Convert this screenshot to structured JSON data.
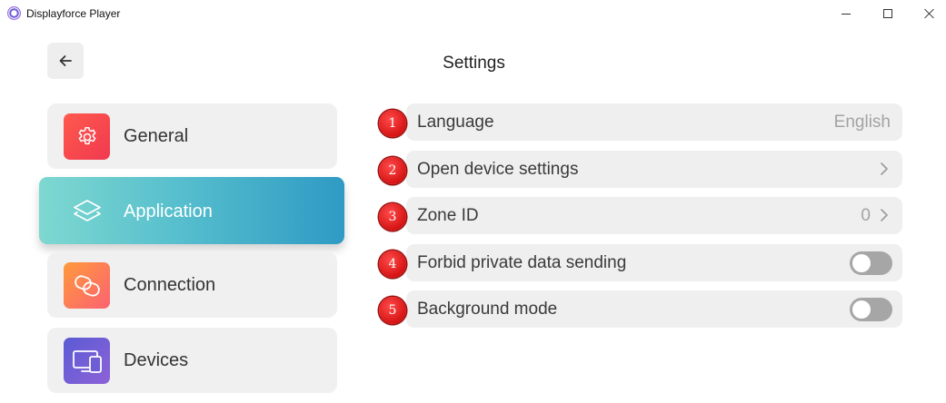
{
  "window": {
    "title": "Displayforce Player",
    "controls": {
      "minimize": "minimize-icon",
      "maximize": "maximize-icon",
      "close": "close-icon"
    }
  },
  "header": {
    "back_icon": "arrow-left-icon",
    "title": "Settings"
  },
  "sidebar": {
    "items": [
      {
        "label": "General",
        "icon": "gear-icon",
        "active": false
      },
      {
        "label": "Application",
        "icon": "layers-icon",
        "active": true
      },
      {
        "label": "Connection",
        "icon": "link-icon",
        "active": false
      },
      {
        "label": "Devices",
        "icon": "monitor-tablet-icon",
        "active": false
      }
    ]
  },
  "settings": {
    "rows": [
      {
        "badge": "1",
        "label": "Language",
        "value": "English",
        "control": "value"
      },
      {
        "badge": "2",
        "label": "Open device settings",
        "control": "chevron"
      },
      {
        "badge": "3",
        "label": "Zone ID",
        "value": "0",
        "control": "value-chevron"
      },
      {
        "badge": "4",
        "label": "Forbid private data sending",
        "control": "toggle",
        "on": false
      },
      {
        "badge": "5",
        "label": "Background mode",
        "control": "toggle",
        "on": false
      }
    ]
  },
  "colors": {
    "active_gradient_start": "#7ed8d0",
    "active_gradient_end": "#2f9ac4",
    "badge_red": "#d61414",
    "toggle_off": "#a6a6a6"
  }
}
